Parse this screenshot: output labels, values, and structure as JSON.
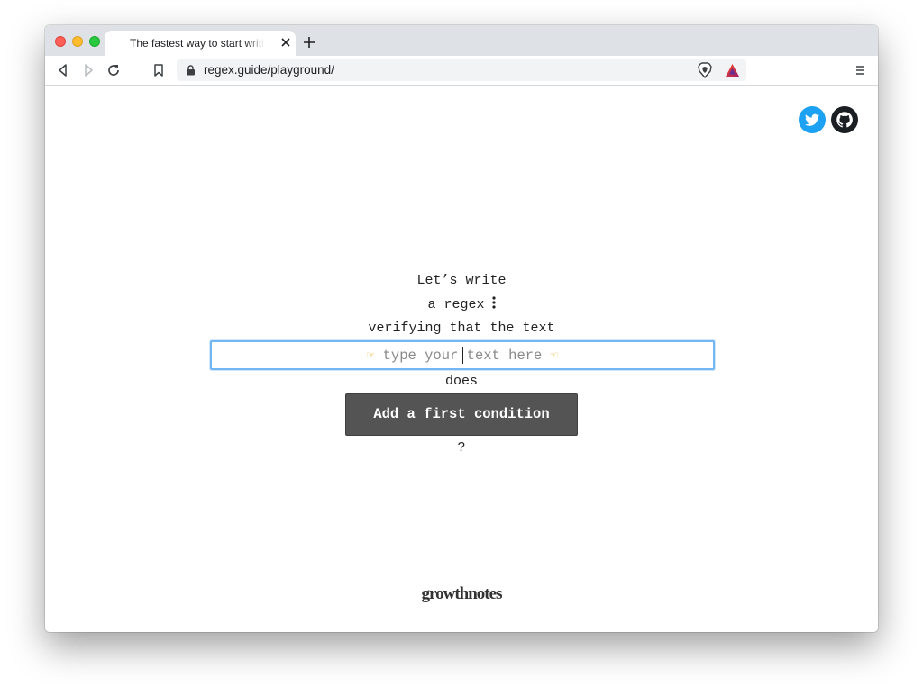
{
  "browser": {
    "tab_title": "The fastest way to start writing regex",
    "url": "regex.guide/playground/"
  },
  "page": {
    "line1": "Let’s write",
    "line2": "a regex",
    "line3": "verifying that the text",
    "input_placeholder": "type your text here",
    "line4": "does",
    "add_button": "Add a first condition",
    "question": "?",
    "brand": "growthnotes"
  },
  "icons": {
    "back": "back-arrow-icon",
    "forward": "forward-arrow-icon",
    "reload": "reload-icon",
    "bookmark": "bookmark-icon",
    "lock": "lock-icon",
    "brave": "brave-shield-icon",
    "rewards": "brave-rewards-icon",
    "menu": "menu-icon",
    "twitter": "twitter-icon",
    "github": "github-icon",
    "pointer_right": "pointing-right-hand-icon",
    "pointer_left": "pointing-left-hand-icon"
  },
  "colors": {
    "twitter": "#1da1f2",
    "button_bg": "#545454",
    "input_focus": "#72b7f3"
  }
}
